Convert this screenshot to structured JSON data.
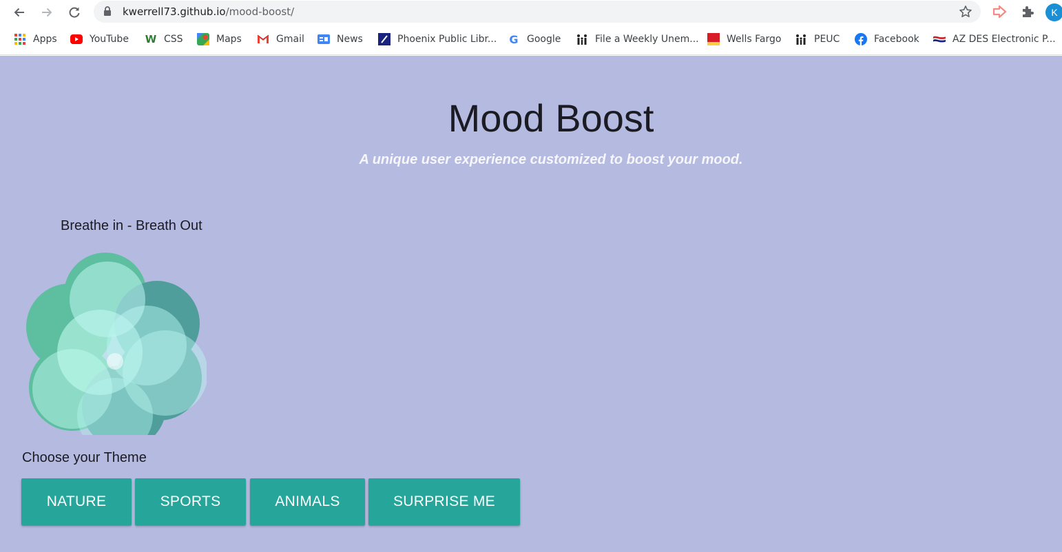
{
  "browser": {
    "url_host": "kwerrell73.github.io",
    "url_path": "/mood-boost/",
    "profile_initial": "K",
    "bookmarks": [
      {
        "label": "Apps",
        "icon": "apps-grid-icon"
      },
      {
        "label": "YouTube",
        "icon": "youtube-icon"
      },
      {
        "label": "CSS",
        "icon": "w3schools-icon"
      },
      {
        "label": "Maps",
        "icon": "maps-icon"
      },
      {
        "label": "Gmail",
        "icon": "gmail-icon"
      },
      {
        "label": "News",
        "icon": "google-news-icon"
      },
      {
        "label": "Phoenix Public Libr...",
        "icon": "library-icon"
      },
      {
        "label": "Google",
        "icon": "google-icon"
      },
      {
        "label": "File a Weekly Unem...",
        "icon": "family-icon"
      },
      {
        "label": "Wells Fargo",
        "icon": "wells-fargo-icon"
      },
      {
        "label": "PEUC",
        "icon": "family-icon"
      },
      {
        "label": "Facebook",
        "icon": "facebook-icon"
      },
      {
        "label": "AZ DES Electronic P...",
        "icon": "flag-icon"
      }
    ]
  },
  "page": {
    "title": "Mood Boost",
    "subtitle": "A unique user experience customized to boost your mood.",
    "breathe_label": "Breathe in - Breath Out",
    "theme_label": "Choose your Theme",
    "themes": [
      {
        "label": "NATURE"
      },
      {
        "label": "SPORTS"
      },
      {
        "label": "ANIMALS"
      },
      {
        "label": "SURPRISE ME"
      }
    ],
    "colors": {
      "background": "#b5bae0",
      "button": "#26a69a",
      "flower_dark": "#4f9e9c",
      "flower_mid": "#5ebea0",
      "flower_light": "#8fdcd8"
    }
  }
}
